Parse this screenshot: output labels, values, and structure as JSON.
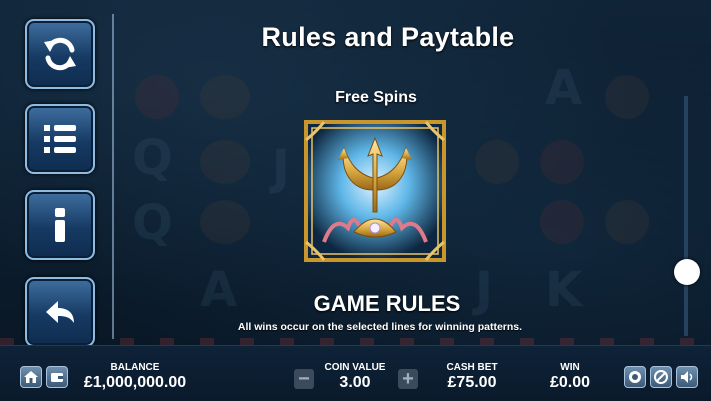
{
  "screen": {
    "title": "Rules and Paytable",
    "section_title": "Free Spins",
    "symbol_icon": "trident-icon",
    "rules_heading": "GAME RULES",
    "rules_text": "All wins occur on the selected lines for winning patterns."
  },
  "menu": [
    {
      "name": "refresh-icon"
    },
    {
      "name": "list-icon"
    },
    {
      "name": "info-icon"
    },
    {
      "name": "back-arrow-icon"
    }
  ],
  "bottom_bar": {
    "balance": {
      "label": "BALANCE",
      "value": "£1,000,000.00"
    },
    "coin_value": {
      "label": "COIN VALUE",
      "value": "3.00",
      "minus": "−",
      "plus": "+"
    },
    "cash_bet": {
      "label": "CASH BET",
      "value": "£75.00"
    },
    "win": {
      "label": "WIN",
      "value": "£0.00"
    },
    "left_icons": [
      "home-icon",
      "wallet-icon"
    ],
    "right_icons": [
      "fullscreen-icon",
      "settings-icon",
      "sound-icon"
    ]
  },
  "scroll": {
    "position": 0.75
  },
  "colors": {
    "background": "#0d2236",
    "button": "#163a63",
    "button_border": "#8fbbe0",
    "gold": "#d8a840"
  }
}
